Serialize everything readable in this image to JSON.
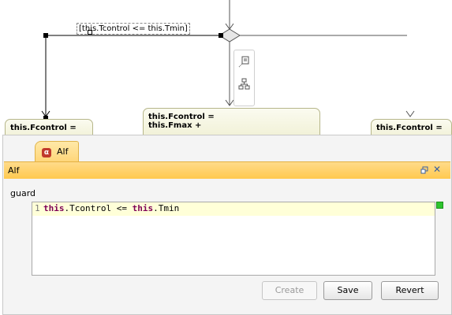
{
  "diagram": {
    "guard_label": "[this.Tcontrol <= this.Tmin]",
    "actions": {
      "left": "this.Fcontrol =",
      "middle_line1": "this.Fcontrol =",
      "middle_line2": "this.Fmax +",
      "right": "this.Fcontrol ="
    },
    "mini_toolbar": {
      "button1_icon": "note-icon",
      "button2_icon": "structure-icon"
    }
  },
  "panel": {
    "tab_label": "Alf",
    "tab_icon": "alf-icon",
    "view_title": "Alf",
    "header_icons": [
      "restore-icon",
      "close-icon"
    ],
    "field_label": "guard",
    "editor": {
      "line_number": "1",
      "code_kw1": "this",
      "code_mid": ".Tcontrol <= ",
      "code_kw2": "this",
      "code_end": ".Tmin"
    },
    "status_color": "#2ec42e",
    "buttons": {
      "create": "Create",
      "save": "Save",
      "revert": "Revert"
    }
  },
  "colors": {
    "header_orange": "#ffc94f",
    "keyword": "#7f0055",
    "action_fill": "#f0f0d4"
  }
}
